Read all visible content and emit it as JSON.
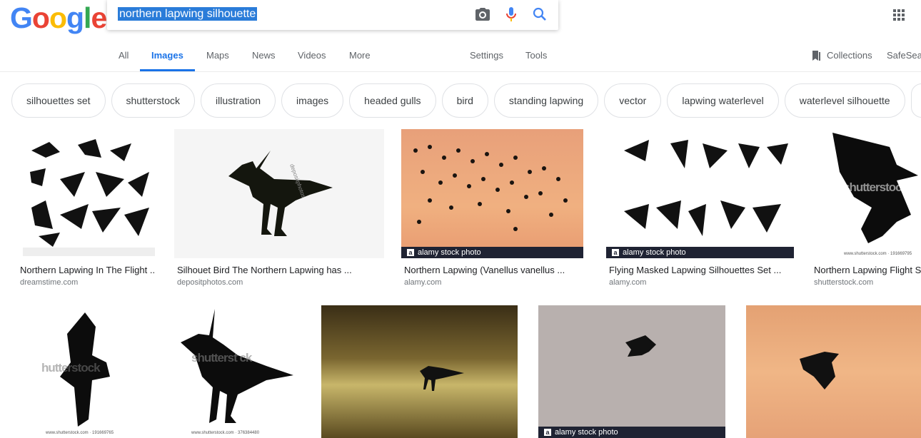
{
  "logo": {
    "letters": [
      "G",
      "o",
      "o",
      "g",
      "l",
      "e"
    ],
    "colors": [
      "#4285f4",
      "#ea4335",
      "#fbbc05",
      "#4285f4",
      "#34a853",
      "#ea4335"
    ]
  },
  "search": {
    "query": "northern lapwing silhouette"
  },
  "tabs": {
    "all": "All",
    "images": "Images",
    "maps": "Maps",
    "news": "News",
    "videos": "Videos",
    "more": "More",
    "settings": "Settings",
    "tools": "Tools",
    "collections": "Collections",
    "safesearch": "SafeSea"
  },
  "chips": [
    "silhouettes set",
    "shutterstock",
    "illustration",
    "images",
    "headed gulls",
    "bird",
    "standing lapwing",
    "vector",
    "lapwing waterlevel",
    "waterlevel silhouette"
  ],
  "results_row1": [
    {
      "caption": "Northern Lapwing In The Flight ...",
      "source": "dreamstime.com"
    },
    {
      "caption": "Silhouet Bird The Northern Lapwing has ...",
      "source": "depositphotos.com"
    },
    {
      "caption": "Northern Lapwing (Vanellus vanellus ...",
      "source": "alamy.com"
    },
    {
      "caption": "Flying Masked Lapwing Silhouettes Set ...",
      "source": "alamy.com"
    },
    {
      "caption": "Northern Lapwing Flight Sto",
      "source": "shutterstock.com"
    }
  ],
  "watermarks": {
    "alamy_bar": "alamy stock photo",
    "shutterstock": "shutterstock",
    "shutterstock_id1": "www.shutterstock.com · 191669795",
    "shutterstock_id2": "www.shutterstock.com · 191669765",
    "shutterstock_id3": "www.shutterstock.com · 376384480",
    "hutterstock": "hutterstock",
    "shutterstock_wm2": "shutterst ck",
    "depositphotos": "depositphotos"
  },
  "colors": {
    "accent": "#1a73e8",
    "chip_border": "#dfe1e5",
    "alamy_bar": "#1f2333"
  }
}
